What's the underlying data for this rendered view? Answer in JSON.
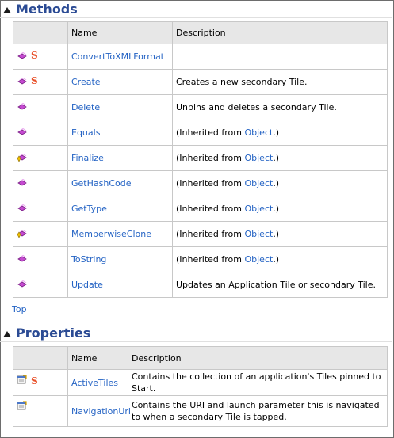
{
  "methods": {
    "title": "Methods",
    "headers": {
      "name": "Name",
      "description": "Description"
    },
    "rows": [
      {
        "icon": "public-method-icon",
        "static": true,
        "name": "ConvertToXMLFormat",
        "desc_pre": "",
        "desc_link": "",
        "desc_post": ""
      },
      {
        "icon": "public-method-icon",
        "static": true,
        "name": "Create",
        "desc_pre": "Creates a new secondary Tile.",
        "desc_link": "",
        "desc_post": ""
      },
      {
        "icon": "public-method-icon",
        "static": false,
        "name": "Delete",
        "desc_pre": "Unpins and deletes a secondary Tile.",
        "desc_link": "",
        "desc_post": ""
      },
      {
        "icon": "public-method-icon",
        "static": false,
        "name": "Equals",
        "desc_pre": "(Inherited from ",
        "desc_link": "Object",
        "desc_post": ".)"
      },
      {
        "icon": "protected-method-icon",
        "static": false,
        "name": "Finalize",
        "desc_pre": "(Inherited from ",
        "desc_link": "Object",
        "desc_post": ".)"
      },
      {
        "icon": "public-method-icon",
        "static": false,
        "name": "GetHashCode",
        "desc_pre": "(Inherited from ",
        "desc_link": "Object",
        "desc_post": ".)"
      },
      {
        "icon": "public-method-icon",
        "static": false,
        "name": "GetType",
        "desc_pre": "(Inherited from ",
        "desc_link": "Object",
        "desc_post": ".)"
      },
      {
        "icon": "protected-method-icon",
        "static": false,
        "name": "MemberwiseClone",
        "desc_pre": "(Inherited from ",
        "desc_link": "Object",
        "desc_post": ".)"
      },
      {
        "icon": "public-method-icon",
        "static": false,
        "name": "ToString",
        "desc_pre": "(Inherited from ",
        "desc_link": "Object",
        "desc_post": ".)"
      },
      {
        "icon": "public-method-icon",
        "static": false,
        "name": "Update",
        "desc_pre": "Updates an Application Tile or secondary Tile.",
        "desc_link": "",
        "desc_post": ""
      }
    ],
    "top_link": "Top"
  },
  "properties": {
    "title": "Properties",
    "headers": {
      "name": "Name",
      "description": "Description"
    },
    "rows": [
      {
        "icon": "public-property-icon",
        "static": true,
        "name": "ActiveTiles",
        "desc": "Contains the collection of an application's Tiles pinned to Start."
      },
      {
        "icon": "public-property-icon",
        "static": false,
        "name": "NavigationUri",
        "desc": "Contains the URI and launch parameter this is navigated to when a secondary Tile is tapped."
      }
    ]
  },
  "static_marker": "S",
  "colors": {
    "heading": "#2b4b94",
    "link": "#2463c4",
    "header_bg": "#e7e7e7",
    "static": "#e8512a",
    "method_icon": "#c54ad0"
  }
}
